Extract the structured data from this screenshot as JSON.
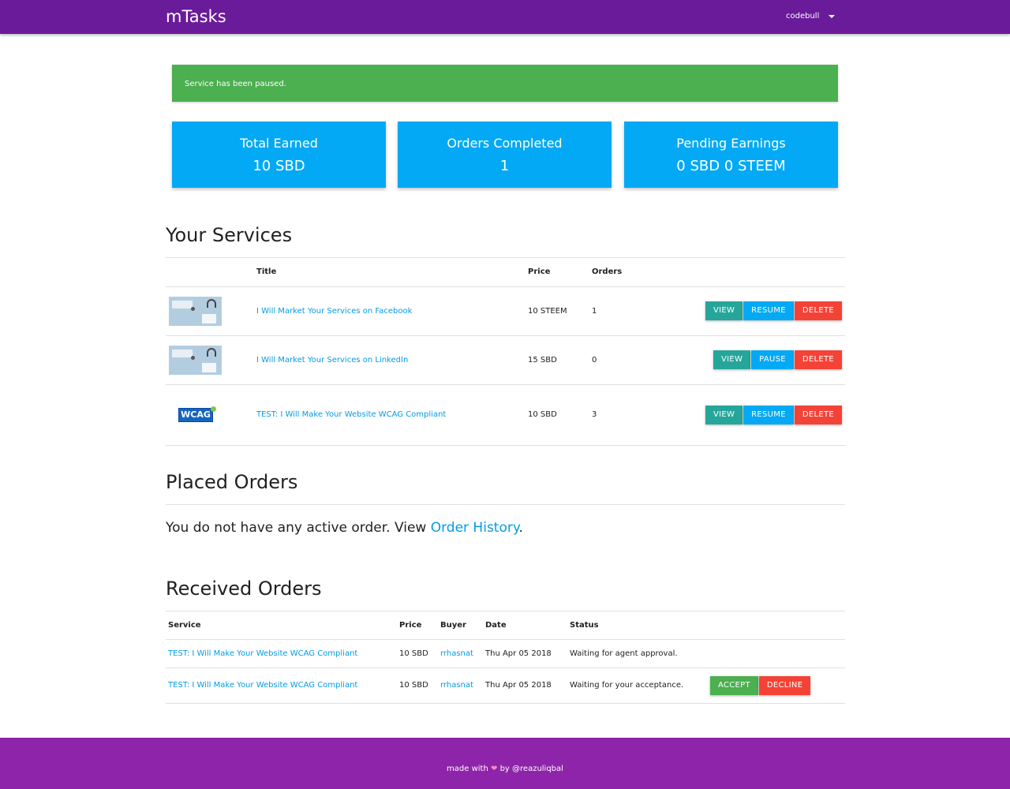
{
  "nav": {
    "brand": "mTasks",
    "username": "codebull"
  },
  "alert": {
    "message": "Service has been paused."
  },
  "stats": [
    {
      "title": "Total Earned",
      "value": "10 SBD"
    },
    {
      "title": "Orders Completed",
      "value": "1"
    },
    {
      "title": "Pending Earnings",
      "value": "0 SBD 0 STEEM"
    }
  ],
  "services": {
    "heading": "Your Services",
    "columns": {
      "title": "Title",
      "price": "Price",
      "orders": "Orders"
    },
    "rows": [
      {
        "thumbnail": "desk-image",
        "title": "I Will Market Your Services on Facebook",
        "price": "10 STEEM",
        "orders": "1",
        "actions": [
          "VIEW",
          "RESUME",
          "DELETE"
        ]
      },
      {
        "thumbnail": "desk-image",
        "title": "I Will Market Your Services on LinkedIn",
        "price": "15 SBD",
        "orders": "0",
        "actions": [
          "VIEW",
          "PAUSE",
          "DELETE"
        ]
      },
      {
        "thumbnail": "wcag-logo",
        "thumbnail_text": "WCAG",
        "title": "TEST: I Will Make Your Website WCAG Compliant",
        "price": "10 SBD",
        "orders": "3",
        "actions": [
          "VIEW",
          "RESUME",
          "DELETE"
        ]
      }
    ]
  },
  "placed": {
    "heading": "Placed Orders",
    "message": "You do not have any active order. View ",
    "link": "Order History",
    "suffix": "."
  },
  "received": {
    "heading": "Received Orders",
    "columns": {
      "service": "Service",
      "price": "Price",
      "buyer": "Buyer",
      "date": "Date",
      "status": "Status"
    },
    "rows": [
      {
        "service": "TEST: I Will Make Your Website WCAG Compliant",
        "price": "10 SBD",
        "buyer": "rrhasnat",
        "date": "Thu Apr 05 2018",
        "status": "Waiting for agent approval.",
        "actions": []
      },
      {
        "service": "TEST: I Will Make Your Website WCAG Compliant",
        "price": "10 SBD",
        "buyer": "rrhasnat",
        "date": "Thu Apr 05 2018",
        "status": "Waiting for your acceptance.",
        "actions": [
          "ACCEPT",
          "DECLINE"
        ]
      }
    ]
  },
  "footer": {
    "prefix": "made with",
    "icon": "heart-icon",
    "suffix": "by @reazuliqbal"
  },
  "colors": {
    "navbar": "#6a1b9a",
    "footer": "#8e24aa",
    "alert": "#4caf50",
    "card": "#03a9f4",
    "teal": "#26a69a",
    "blue": "#03a9f4",
    "red": "#f44336",
    "green": "#4caf50",
    "link": "#039be5"
  }
}
